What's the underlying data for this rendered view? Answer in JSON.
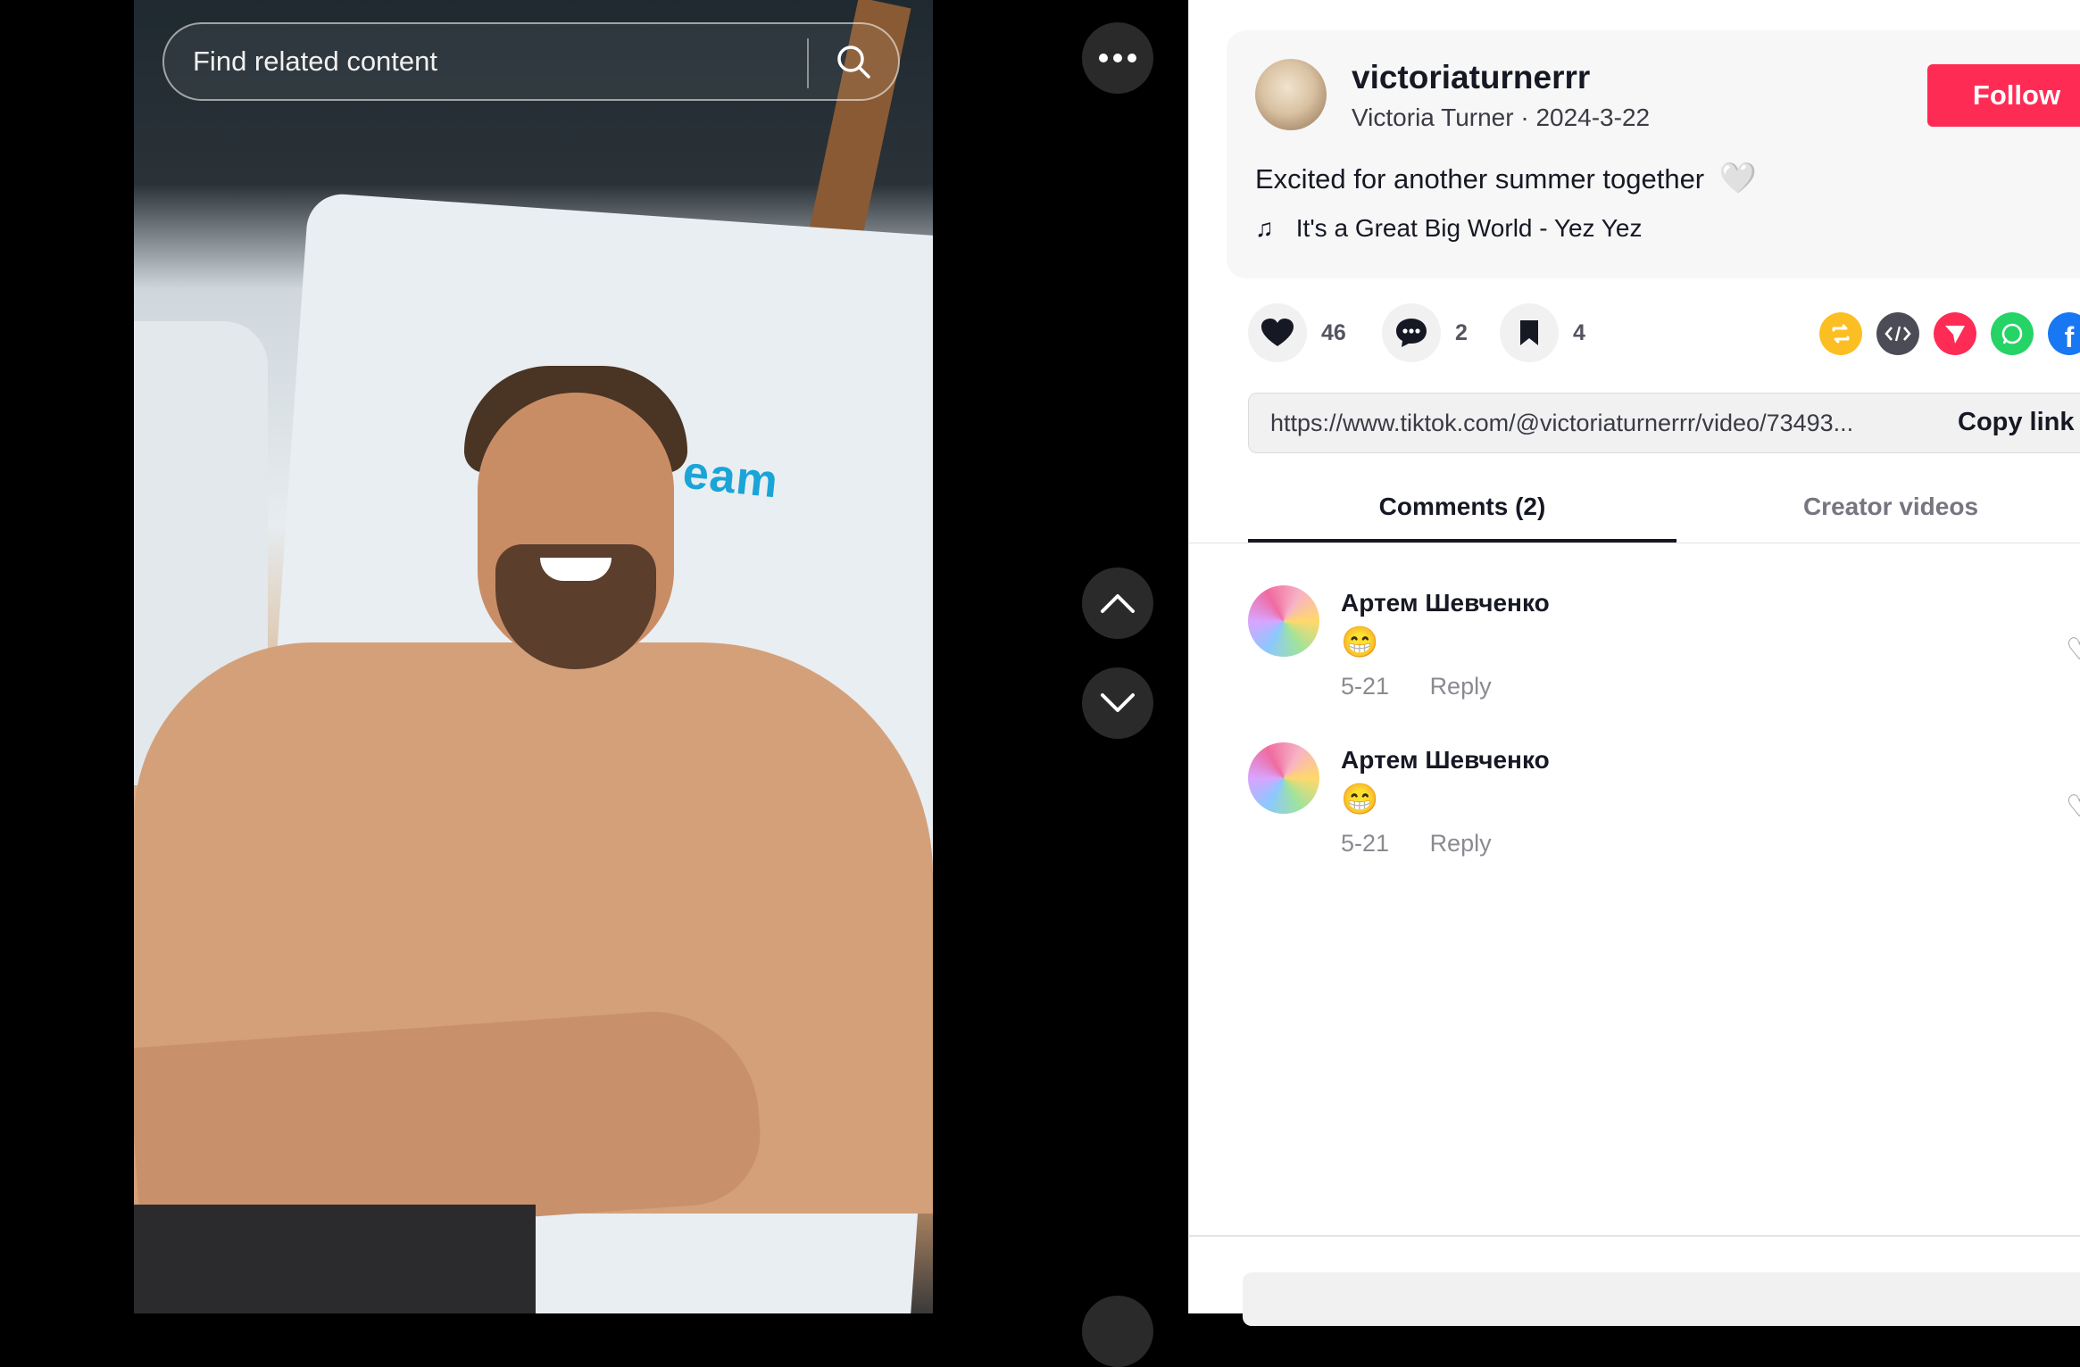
{
  "search": {
    "placeholder": "Find related content"
  },
  "video": {
    "towel_text": "eam"
  },
  "author": {
    "username": "victoriaturnerrr",
    "display_name": "Victoria Turner",
    "date": "2024-3-22",
    "subline": "Victoria Turner · 2024-3-22",
    "follow_label": "Follow"
  },
  "post": {
    "caption": "Excited for another summer together",
    "caption_emoji": "🤍",
    "music": "It's a Great Big World - Yez Yez"
  },
  "stats": {
    "likes": "46",
    "comments": "2",
    "saves": "4"
  },
  "share_icons": [
    "repost-icon",
    "embed-icon",
    "send-icon",
    "whatsapp-icon",
    "facebook-icon"
  ],
  "share_colors": {
    "repost": "#fbbf24",
    "embed": "#4b4c55",
    "send": "#fe2c55",
    "whatsapp": "#25d366",
    "facebook": "#1877f2"
  },
  "link": {
    "url": "https://www.tiktok.com/@victoriaturnerrr/video/73493...",
    "copy_label": "Copy link"
  },
  "tabs": {
    "comments": "Comments (2)",
    "creator": "Creator videos"
  },
  "comments": [
    {
      "name": "Артем Шевченко",
      "text": "😁",
      "date": "5-21",
      "reply": "Reply"
    },
    {
      "name": "Артем Шевченко",
      "text": "😁",
      "date": "5-21",
      "reply": "Reply"
    }
  ],
  "colors": {
    "accent": "#fe2c55"
  }
}
